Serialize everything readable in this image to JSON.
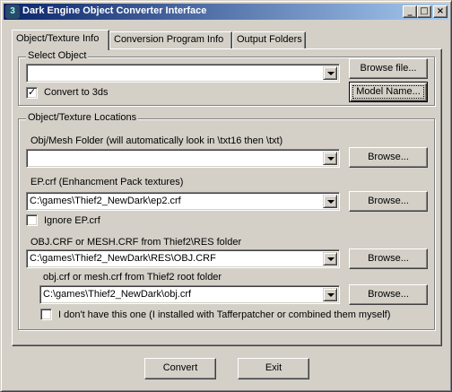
{
  "window": {
    "title": "Dark Engine Object Converter Interface",
    "app_icon": "3",
    "controls": {
      "minimize": "_",
      "maximize": "□",
      "close": "×"
    }
  },
  "tabs": [
    {
      "label": "Object/Texture Info",
      "active": true
    },
    {
      "label": "Conversion Program Info",
      "active": false
    },
    {
      "label": "Output Folders",
      "active": false
    }
  ],
  "select_object": {
    "group_label": "Select Object",
    "combo_value": "",
    "browse_file_label": "Browse file...",
    "model_name_label": "Model Name...",
    "convert_to_3ds": {
      "label": "Convert to 3ds",
      "checked": true,
      "mark": "✓"
    }
  },
  "locations": {
    "group_label": "Object/Texture Locations",
    "obj_mesh_folder": {
      "label": "Obj/Mesh Folder (will automatically look in \\txt16 then \\txt)",
      "value": "",
      "browse_label": "Browse..."
    },
    "ep_crf": {
      "label": "EP.crf (Enhancment Pack textures)",
      "value": "C:\\games\\Thief2_NewDark\\ep2.crf",
      "browse_label": "Browse..."
    },
    "ignore_ep": {
      "label": "Ignore EP.crf",
      "checked": false
    },
    "obj_crf_res": {
      "label": "OBJ.CRF or MESH.CRF from Thief2\\RES folder",
      "value": "C:\\games\\Thief2_NewDark\\RES\\OBJ.CRF",
      "browse_label": "Browse..."
    },
    "obj_crf_root": {
      "label": "obj.crf or mesh.crf from Thief2 root folder",
      "value": "C:\\games\\Thief2_NewDark\\obj.crf",
      "browse_label": "Browse..."
    },
    "dont_have": {
      "label": "I don't have this one (I installed with Tafferpatcher or combined them myself)",
      "checked": false
    }
  },
  "footer": {
    "convert_label": "Convert",
    "exit_label": "Exit"
  }
}
